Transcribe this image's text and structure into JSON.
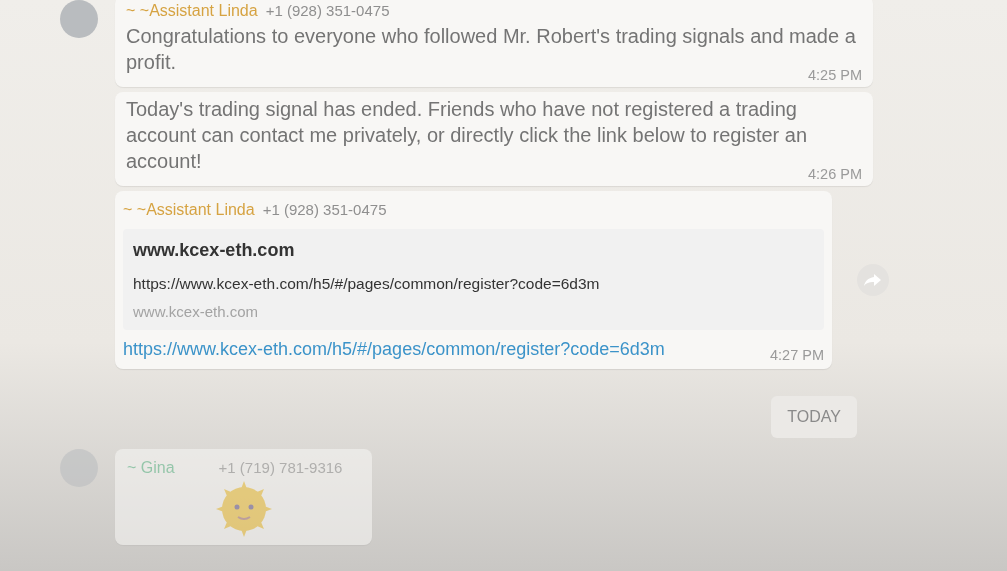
{
  "messages": [
    {
      "kind": "text",
      "sender": "~ ~Assistant Linda",
      "phone": "+1 (928) 351-0475",
      "avatar": true,
      "text": "Congratulations to everyone who followed Mr. Robert's trading signals and made a profit.",
      "time": "4:25 PM"
    },
    {
      "kind": "text",
      "text": "Today's trading signal has ended. Friends who have not registered a trading account can contact me privately, or directly click the link below to register an account!",
      "time": "4:26 PM"
    },
    {
      "kind": "link",
      "sender": "~ ~Assistant Linda",
      "phone": "+1 (928) 351-0475",
      "preview": {
        "title": "www.kcex-eth.com",
        "url": "https://www.kcex-eth.com/h5/#/pages/common/register?code=6d3m",
        "domain": "www.kcex-eth.com"
      },
      "link": "https://www.kcex-eth.com/h5/#/pages/common/register?code=6d3m",
      "time": "4:27 PM",
      "forward": true
    },
    {
      "kind": "date",
      "text": "TODAY"
    },
    {
      "kind": "sticker",
      "sender": "~ Gina",
      "phone": "+1 (719) 781-9316",
      "avatar": true
    }
  ]
}
